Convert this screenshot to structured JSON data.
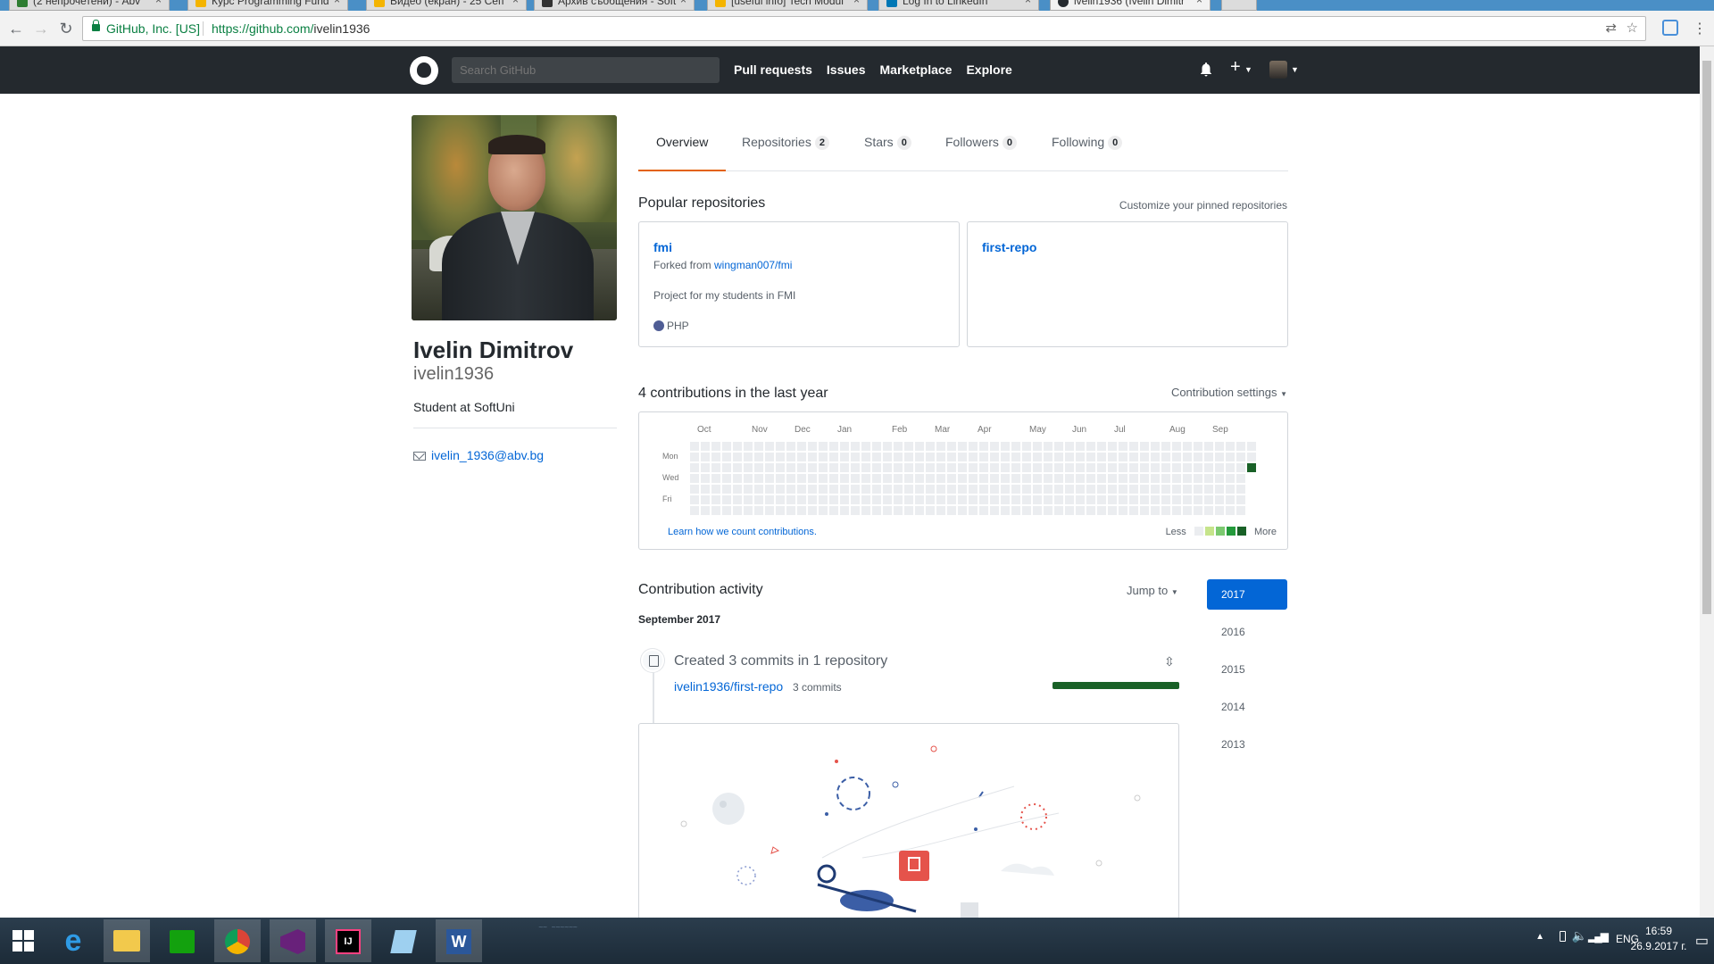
{
  "browser": {
    "tabs": [
      {
        "label": "(2 непрочетени) - Abv",
        "color": "#2e7d32"
      },
      {
        "label": "Курс Programming Fund",
        "color": "#f4b400"
      },
      {
        "label": "Видео (екран) - 25 Сеп",
        "color": "#f4b400"
      },
      {
        "label": "Архив съобщения - Soft",
        "color": "#333333"
      },
      {
        "label": "[useful info] Tech Modul",
        "color": "#f4b400"
      },
      {
        "label": "Log In to LinkedIn",
        "color": "#0077b5"
      },
      {
        "label": "ivelin1936 (Ivelin Dimitr",
        "color": "#24292e"
      }
    ],
    "secure_label": "GitHub, Inc. [US]",
    "url_prefix": "https://github.com/",
    "url_path": "ivelin1936"
  },
  "github_header": {
    "search_placeholder": "Search GitHub",
    "nav": [
      "Pull requests",
      "Issues",
      "Marketplace",
      "Explore"
    ],
    "icons": [
      "bell-icon",
      "plus-icon",
      "avatar"
    ]
  },
  "profile": {
    "full_name": "Ivelin Dimitrov",
    "username": "ivelin1936",
    "bio": "Student at SoftUni",
    "email": "ivelin_1936@abv.bg"
  },
  "profile_tabs": [
    {
      "label": "Overview",
      "count": null,
      "selected": true
    },
    {
      "label": "Repositories",
      "count": "2"
    },
    {
      "label": "Stars",
      "count": "0"
    },
    {
      "label": "Followers",
      "count": "0"
    },
    {
      "label": "Following",
      "count": "0"
    }
  ],
  "popular": {
    "title": "Popular repositories",
    "customize": "Customize your pinned repositories",
    "repos": [
      {
        "name": "fmi",
        "forked_prefix": "Forked from ",
        "forked_from": "wingman007/fmi",
        "description": "Project for my students in FMI",
        "language": "PHP",
        "language_color": "#4F5D95"
      },
      {
        "name": "first-repo"
      }
    ]
  },
  "contributions": {
    "title": "4 contributions in the last year",
    "settings": "Contribution settings",
    "months": [
      "Oct",
      "Nov",
      "Dec",
      "Jan",
      "Feb",
      "Mar",
      "Apr",
      "May",
      "Jun",
      "Jul",
      "Aug",
      "Sep"
    ],
    "days": [
      "Mon",
      "Wed",
      "Fri"
    ],
    "learn": "Learn how we count contributions.",
    "less": "Less",
    "more": "More",
    "legend_colors": [
      "#ebedf0",
      "#c6e48b",
      "#7bc96f",
      "#239a3b",
      "#196127"
    ],
    "active_cell_color": "#196127"
  },
  "activity": {
    "title": "Contribution activity",
    "jump_to": "Jump to",
    "years": [
      "2017",
      "2016",
      "2015",
      "2014",
      "2013"
    ],
    "selected_year": "2017",
    "month_header": "September 2017",
    "created": "Created 3 commits in 1 repository",
    "repo": "ivelin1936/first-repo",
    "commits": "3 commits"
  },
  "taskbar": {
    "apps": [
      "start-button",
      "ie-icon",
      "explorer-icon",
      "store-icon",
      "chrome-icon",
      "visual-studio-icon",
      "intellij-icon",
      "notepad-icon",
      "word-icon"
    ],
    "language": "ENG",
    "time": "16:59",
    "date": "26.9.2017 г."
  }
}
